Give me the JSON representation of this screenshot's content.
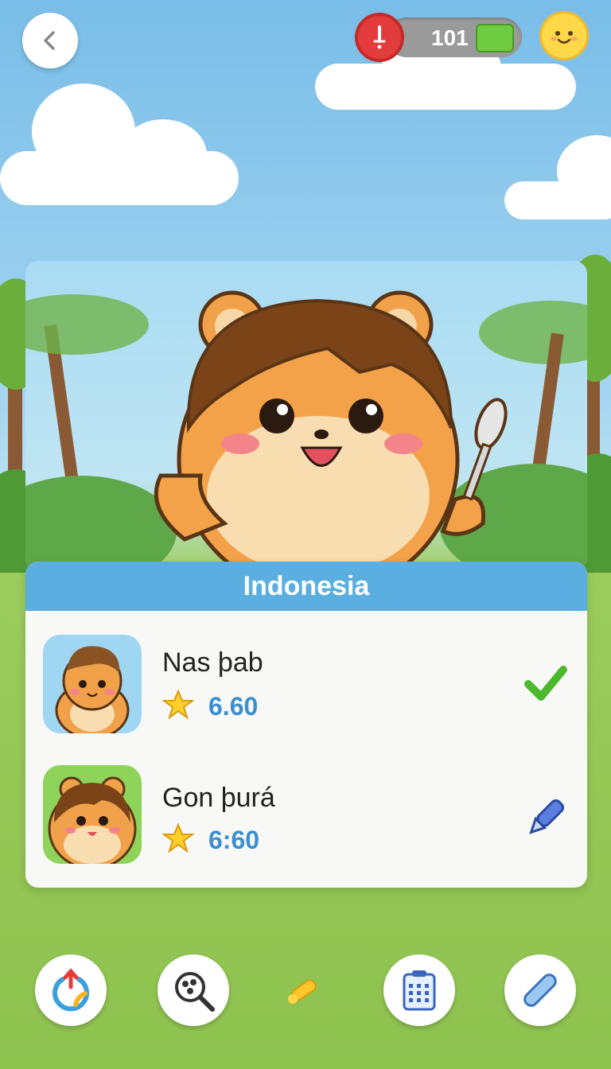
{
  "header": {
    "coin_count": "101",
    "back_icon": "chevron-left-icon",
    "alert_icon": "alert-icon",
    "profile_icon": "smiley-face-icon"
  },
  "card": {
    "title": "Indonesia",
    "entries": [
      {
        "name": "Nas þab",
        "score": "6.60",
        "status_icon": "checkmark-icon"
      },
      {
        "name": "Gon þurá",
        "score": "6:60",
        "status_icon": "pen-icon"
      }
    ]
  },
  "dock": {
    "items": [
      "refresh-icon",
      "magnifier-icon",
      "star-sparkle-icon",
      "calendar-icon",
      "bandage-icon"
    ]
  },
  "colors": {
    "header_blue": "#5aaee0",
    "score_blue": "#3b8fd0",
    "check_green": "#4cb82e",
    "alert_red": "#e23c3c"
  }
}
